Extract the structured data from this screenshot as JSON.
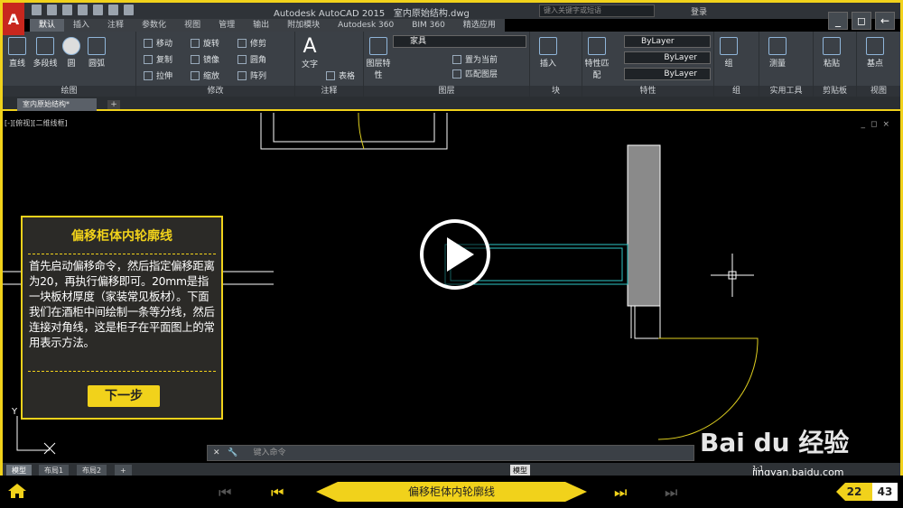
{
  "title_bar": {
    "app_title": "Autodesk AutoCAD 2015",
    "file_name": "室内原始结构.dwg",
    "search_placeholder": "键入关键字或短语",
    "login": "登录",
    "app_logo": "A"
  },
  "ribbon_tabs": [
    "默认",
    "插入",
    "注释",
    "参数化",
    "视图",
    "管理",
    "输出",
    "附加模块",
    "Autodesk 360",
    "BIM 360",
    "精选应用"
  ],
  "active_tab": "默认",
  "ribbon": {
    "draw": {
      "label": "绘图",
      "tools": [
        "直线",
        "多段线",
        "圆",
        "圆弧"
      ]
    },
    "modify": {
      "label": "修改",
      "tools": [
        "移动",
        "旋转",
        "修剪",
        "复制",
        "镜像",
        "圆角",
        "拉伸",
        "缩放",
        "阵列"
      ]
    },
    "annotation": {
      "label": "注释",
      "tools": [
        "文字",
        "表格"
      ]
    },
    "layers": {
      "label": "图层",
      "tools": [
        "图层特性",
        "置为当前",
        "匹配图层"
      ],
      "current_layer": "家具"
    },
    "block": {
      "label": "块",
      "tools": [
        "插入"
      ]
    },
    "properties": {
      "label": "特性",
      "tools": [
        "特性匹配"
      ],
      "color": "ByLayer",
      "linetype": "ByLayer",
      "lineweight": "ByLayer"
    },
    "groups": {
      "label": "组",
      "tools": [
        "组"
      ]
    },
    "utilities": {
      "label": "实用工具",
      "tools": [
        "测量"
      ]
    },
    "clipboard": {
      "label": "剪贴板",
      "tools": [
        "粘贴"
      ]
    },
    "view": {
      "label": "视图",
      "tools": [
        "基点"
      ]
    }
  },
  "file_tab": {
    "name": "室内原始结构*",
    "add": "+"
  },
  "viewport": {
    "label": "[-][俯视][二维线框]",
    "controls": [
      "_",
      "◻",
      "×"
    ]
  },
  "dialog": {
    "title": "偏移柜体内轮廓线",
    "body": "首先启动偏移命令，然后指定偏移距离为20，再执行偏移即可。20mm是指一块板材厚度（家装常见板材）。下面我们在酒柜中间绘制一条等分线，然后连接对角线，这是柜子在平面图上的常用表示方法。",
    "next_button": "下一步"
  },
  "command_line": {
    "placeholder": "键入命令"
  },
  "status_bar": {
    "layout_tabs": [
      "模型",
      "布局1",
      "布局2"
    ],
    "add_layout": "+",
    "model_button": "模型",
    "scale": "1:1"
  },
  "ucs": {
    "x": "X",
    "y": "Y"
  },
  "bottom_nav": {
    "step_title": "偏移柜体内轮廓线",
    "current_page": "22",
    "total_pages": "43"
  },
  "watermark": {
    "brand": "Bai du 经验",
    "url": "jingyan.baidu.com"
  },
  "colors": {
    "accent": "#f1d21b",
    "ribbon_bg": "#3b4046",
    "canvas_bg": "#000000",
    "cyan_line": "#2ec9c9",
    "yellow_arc": "#e0d020"
  }
}
